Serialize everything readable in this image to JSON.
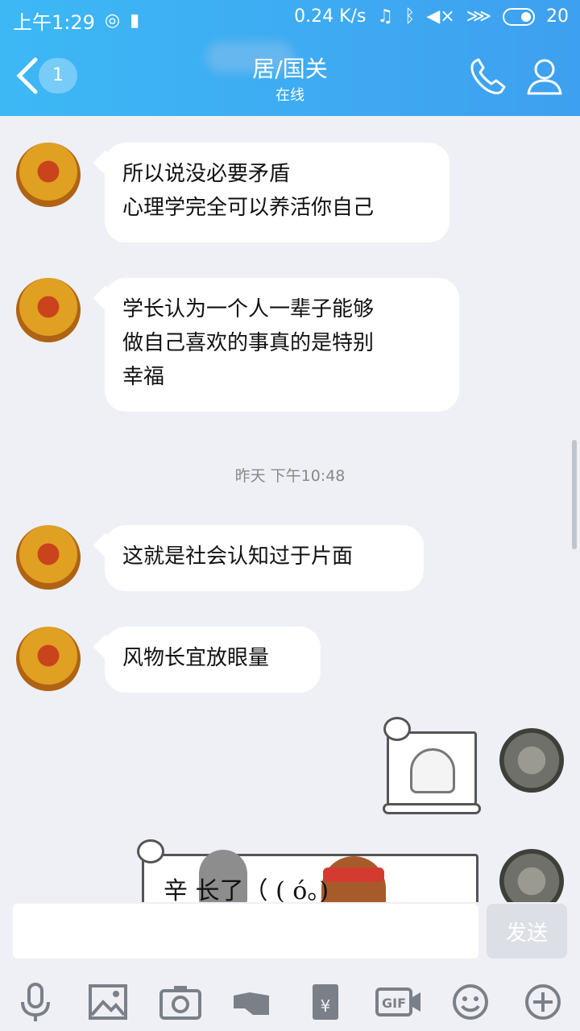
{
  "status_bar": {
    "time": "上午1:29",
    "net_speed": "0.24 K/s",
    "battery": "20"
  },
  "header": {
    "unread_count": "1",
    "title": "居/国关",
    "presence": "在线"
  },
  "messages": [
    {
      "lines": [
        "所以说没必要矛盾",
        "心理学完全可以养活你自己"
      ]
    },
    {
      "lines": [
        "学长认为一个人一辈子能够",
        "做自己喜欢的事真的是特别",
        "幸福"
      ]
    },
    {
      "lines": [
        "这就是社会认知过于片面"
      ]
    },
    {
      "lines": [
        "风物长宜放眼量"
      ]
    }
  ],
  "timestamp": "昨天 下午10:48",
  "sticker2_text": "辛  长了（  (  ó。)",
  "input": {
    "value": "",
    "send_label": "发送"
  },
  "toolbar": [
    "mic-icon",
    "image-icon",
    "camera-icon",
    "hand-icon",
    "redpacket-icon",
    "gif-icon",
    "emoji-icon",
    "plus-icon"
  ],
  "colors": {
    "header": "#3ea0f0",
    "background": "#eef0f6",
    "send_disabled": "#dcdfe6"
  }
}
